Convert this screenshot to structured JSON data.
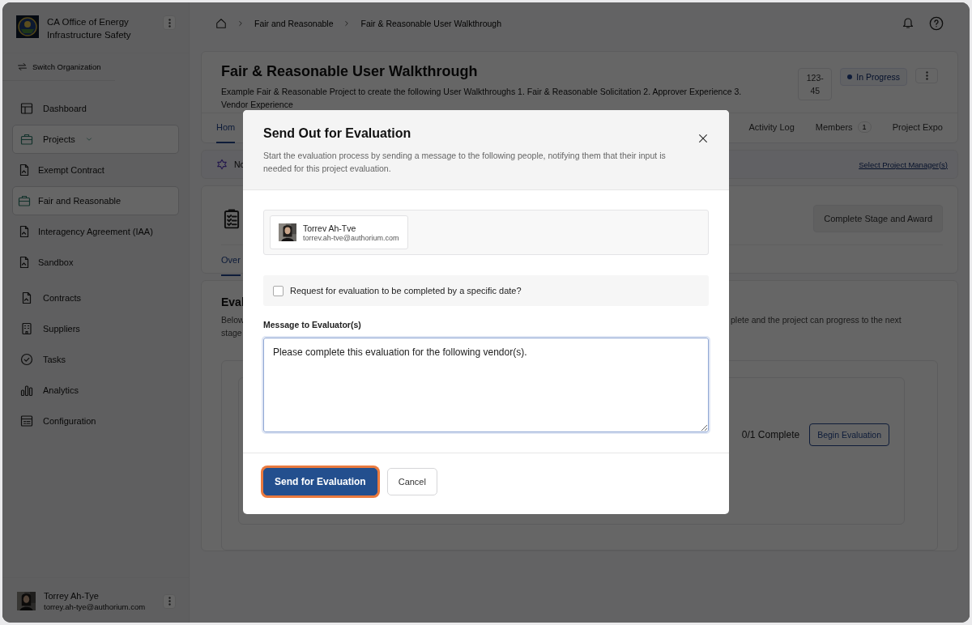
{
  "sidebar": {
    "org_name": "CA Office of Energy Infrastructure Safety",
    "switch_label": "Switch Organization",
    "nav": [
      {
        "label": "Dashboard",
        "selected": false
      },
      {
        "label": "Projects",
        "selected": true,
        "expanded": true,
        "children": [
          {
            "label": "Exempt Contract",
            "selected": false
          },
          {
            "label": "Fair and Reasonable",
            "selected": true
          },
          {
            "label": "Interagency Agreement (IAA)",
            "selected": false
          },
          {
            "label": "Sandbox",
            "selected": false
          }
        ]
      },
      {
        "label": "Contracts",
        "selected": false
      },
      {
        "label": "Suppliers",
        "selected": false
      },
      {
        "label": "Tasks",
        "selected": false
      },
      {
        "label": "Analytics",
        "selected": false
      },
      {
        "label": "Configuration",
        "selected": false
      }
    ],
    "user": {
      "name": "Torrey Ah-Tye",
      "email": "torrey.ah-tye@authorium.com"
    }
  },
  "breadcrumbs": [
    "Fair and Reasonable",
    "Fair & Reasonable User Walkthrough"
  ],
  "project": {
    "title": "Fair & Reasonable User Walkthrough",
    "description": "Example Fair & Reasonable Project to create the following User Walkthroughs 1. Fair & Reasonable Solicitation 2. Approver Experience 3. Vendor Experience",
    "id": "123-45",
    "status": "In Progress"
  },
  "tabs": [
    {
      "label": "Hom",
      "selected": true
    },
    {
      "label": "Activity Log",
      "selected": false
    },
    {
      "label": "Members",
      "count": "1",
      "selected": false
    },
    {
      "label": "Project Expo",
      "selected": false
    }
  ],
  "notice": {
    "text": "No",
    "link": "Select Project Manager(s)"
  },
  "stage": {
    "action": "Complete Stage and Award",
    "disabled": true,
    "subtab": {
      "label": "Over",
      "selected": true
    }
  },
  "evaluation": {
    "title": "Eval",
    "description_left": [
      "Below",
      "stage"
    ],
    "description_right": "plete and the project can progress to the next",
    "progress": "0/1 Complete",
    "button": "Begin Evaluation"
  },
  "modal": {
    "title": "Send Out for Evaluation",
    "description": "Start the evaluation process by sending a message to the following people, notifying them that their input is needed for this project evaluation.",
    "recipients": [
      {
        "name": "Torrev Ah-Tve",
        "email": "torrev.ah-tve@authorium.com"
      }
    ],
    "date_request": {
      "label": "Request for evaluation to be completed by a specific date?",
      "checked": false
    },
    "message": {
      "label": "Message to Evaluator(s)",
      "value": "Please complete this evaluation for the following vendor(s)."
    },
    "buttons": [
      {
        "label": "Send for Evaluation",
        "kind": "primary",
        "focused": true
      },
      {
        "label": "Cancel",
        "kind": "secondary",
        "focused": false
      }
    ]
  }
}
